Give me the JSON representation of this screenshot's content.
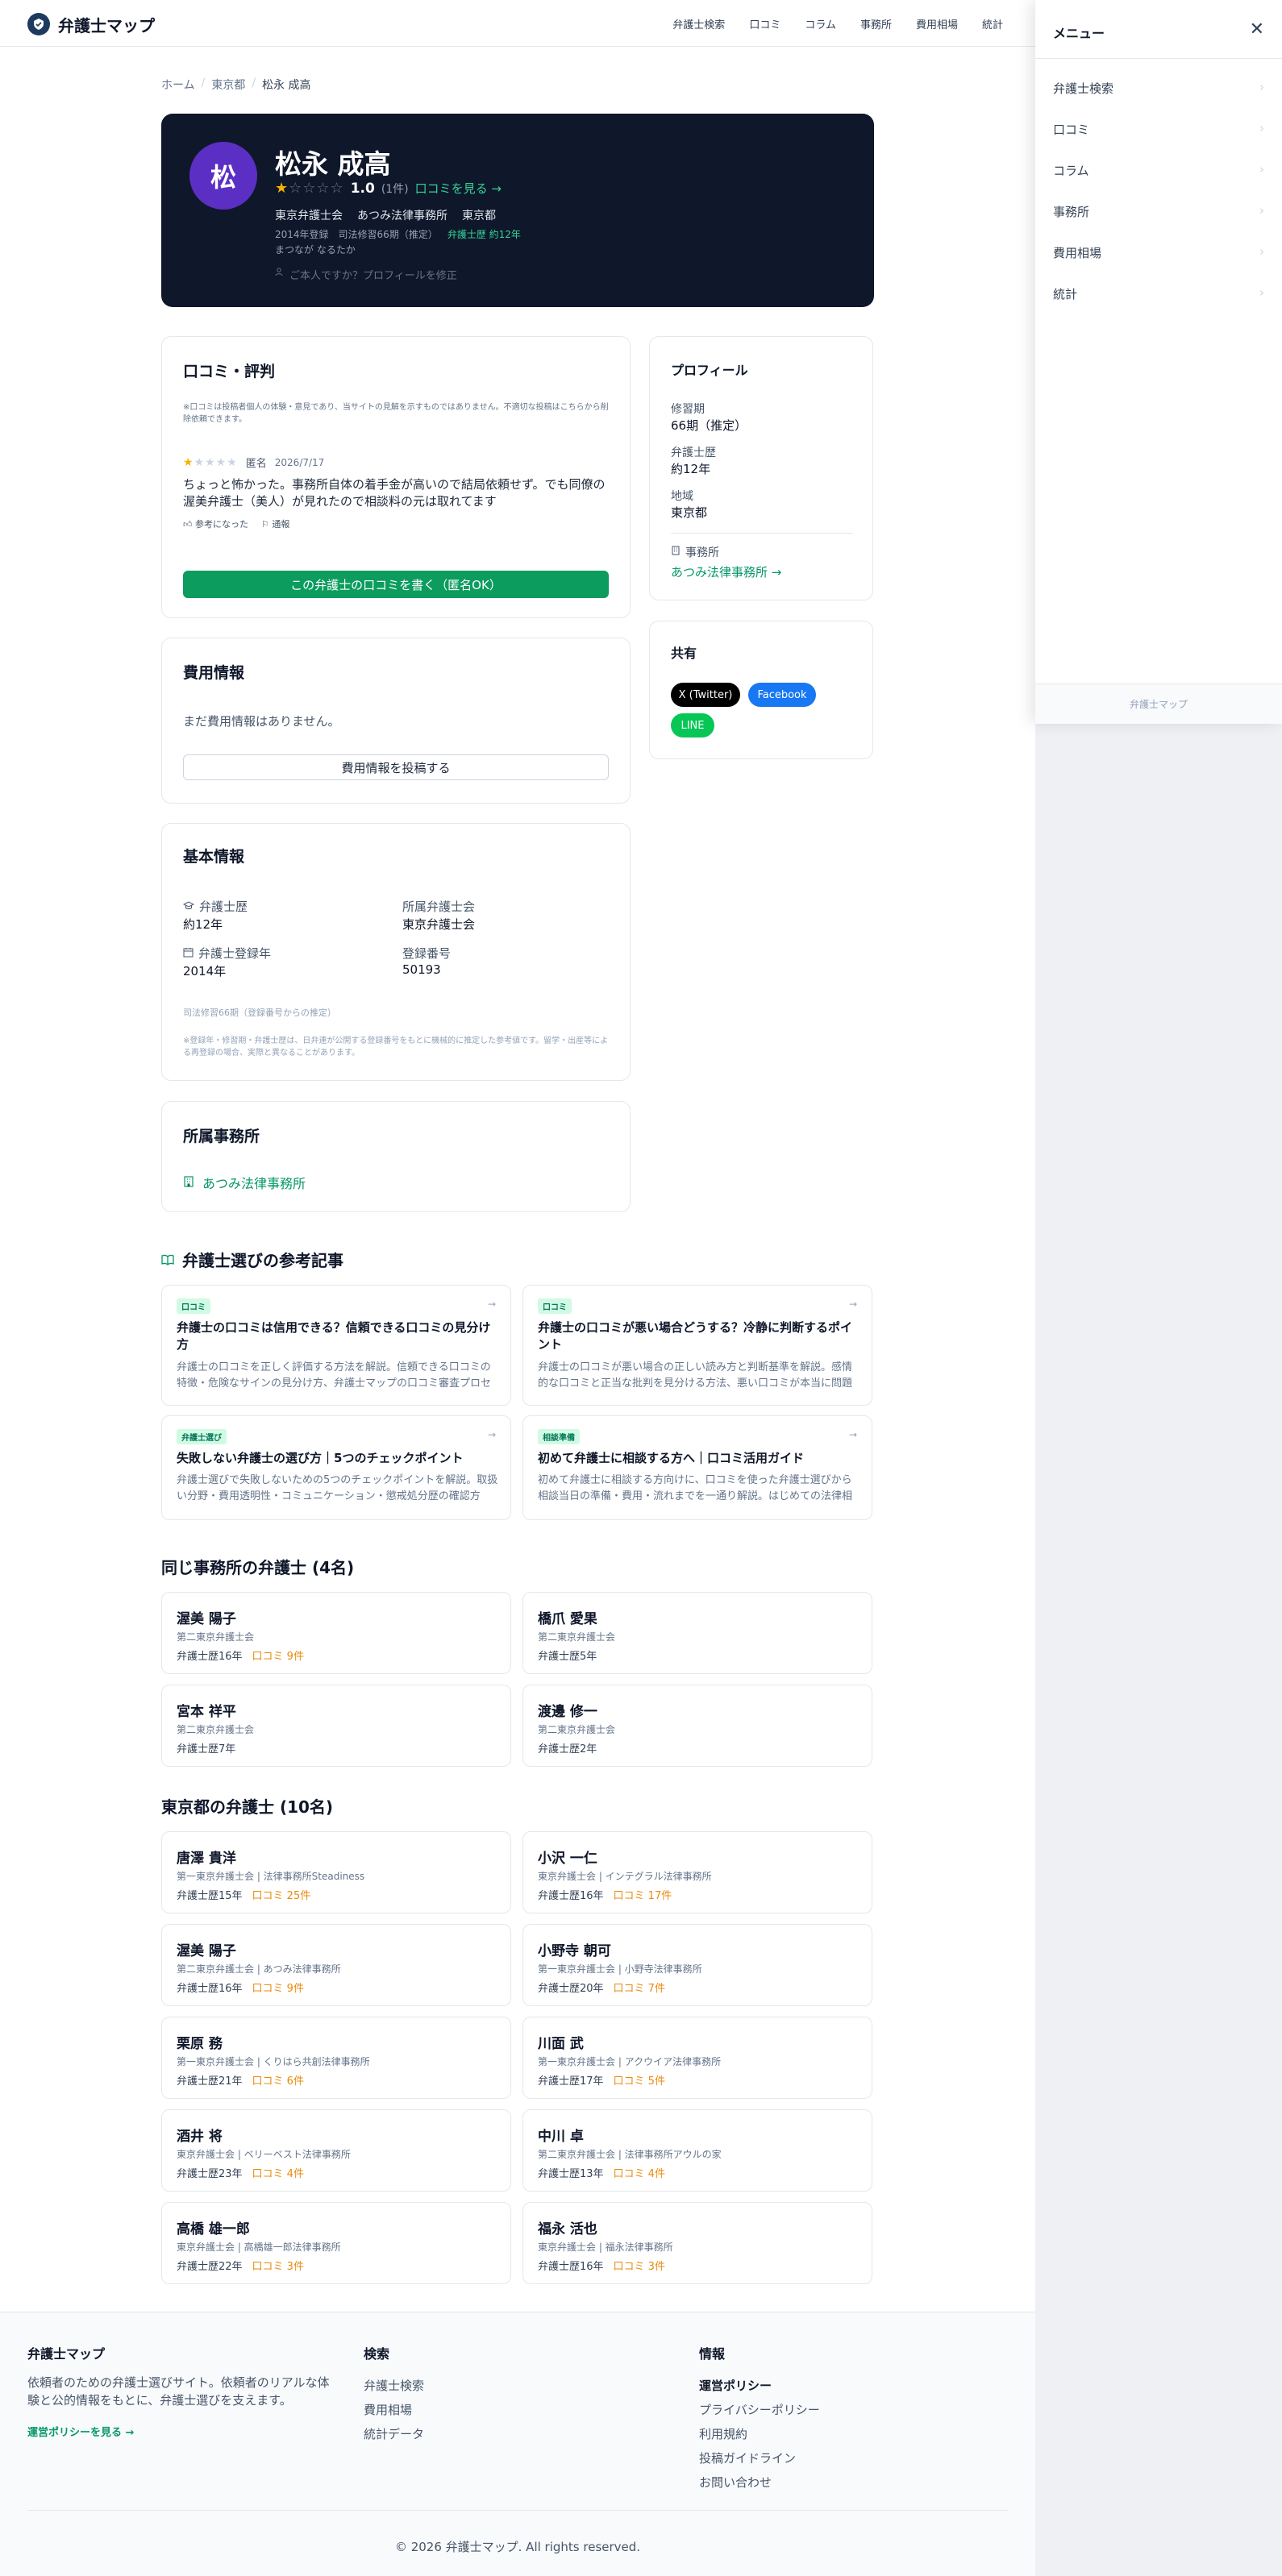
{
  "header": {
    "logo_text": "弁護士マップ",
    "nav": [
      "弁護士検索",
      "口コミ",
      "コラム",
      "事務所",
      "費用相場",
      "統計"
    ]
  },
  "breadcrumb": {
    "home": "ホーム",
    "region": "東京都",
    "current": "松永 成高"
  },
  "hero": {
    "avatar_char": "松",
    "name": "松永 成高",
    "rating": "1.0",
    "rating_value": 1,
    "rating_max": 5,
    "review_count": "(1件)",
    "reviews_link": "口コミを見る →",
    "bar": "東京弁護士会",
    "office": "あつみ法律事務所",
    "region": "東京都",
    "registered": "2014年登録",
    "training": "司法修習66期（推定）",
    "experience": "弁護士歴 約12年",
    "kana": "まつなが なるたか",
    "claim": "ご本人ですか？プロフィールを修正"
  },
  "reviews": {
    "title": "口コミ・評判",
    "notice": "※口コミは投稿者個人の体験・意見であり、当サイトの見解を示すものではありません。不適切な投稿はこちらから削除依頼できます。",
    "items": [
      {
        "rating": 1,
        "author": "匿名",
        "date": "2026/7/17",
        "body": "ちょっと怖かった。事務所自体の着手金が高いので結局依頼せず。でも同僚の渥美弁護士（美人）が見れたので相談料の元は取れてます",
        "helpful": "参考になった",
        "report": "通報"
      }
    ],
    "write_button": "この弁護士の口コミを書く（匿名OK）"
  },
  "profile": {
    "title": "プロフィール",
    "fields": [
      {
        "label": "修習期",
        "value": "66期（推定）"
      },
      {
        "label": "弁護士歴",
        "value": "約12年"
      },
      {
        "label": "地域",
        "value": "東京都"
      }
    ],
    "office_label": "事務所",
    "office_link": "あつみ法律事務所 →"
  },
  "share": {
    "title": "共有",
    "buttons": [
      "X (Twitter)",
      "Facebook",
      "LINE"
    ],
    "colors": {
      "x": "#000000",
      "facebook": "#1877f2",
      "line": "#06c755"
    }
  },
  "fees": {
    "title": "費用情報",
    "empty": "まだ費用情報はありません。",
    "post_button": "費用情報を投稿する"
  },
  "basic": {
    "title": "基本情報",
    "exp_label": "弁護士歴",
    "exp_value": "約12年",
    "bar_label": "所属弁護士会",
    "bar_value": "東京弁護士会",
    "reg_label": "弁護士登録年",
    "reg_value": "2014年",
    "num_label": "登録番号",
    "num_value": "50193",
    "note1": "司法修習66期（登録番号からの推定）",
    "note2": "※登録年・修習期・弁護士歴は、日弁連が公開する登録番号をもとに機械的に推定した参考値です。留学・出産等による再登録の場合、実際と異なることがあります。"
  },
  "office_card": {
    "title": "所属事務所",
    "link": "あつみ法律事務所"
  },
  "articles_section": {
    "title": "弁護士選びの参考記事",
    "items": [
      {
        "tag": "口コミ",
        "title": "弁護士の口コミは信用できる？信頼できる口コミの見分け方",
        "desc": "弁護士の口コミを正しく評価する方法を解説。信頼できる口コミの特徴・危険なサインの見分け方、弁護士マップの口コミ審査プロセス…"
      },
      {
        "tag": "口コミ",
        "title": "弁護士の口コミが悪い場合どうする？冷静に判断するポイント",
        "desc": "弁護士の口コミが悪い場合の正しい読み方と判断基準を解説。感情的な口コミと正当な批判を見分ける方法、悪い口コミが本当に問題に…"
      },
      {
        "tag": "弁護士選び",
        "title": "失敗しない弁護士の選び方｜5つのチェックポイント",
        "desc": "弁護士選びで失敗しないための5つのチェックポイントを解説。取扱い分野・費用透明性・コミュニケーション・懲戒処分歴の確認方法。"
      },
      {
        "tag": "相談準備",
        "title": "初めて弁護士に相談する方へ｜口コミ活用ガイド",
        "desc": "初めて弁護士に相談する方向けに、口コミを使った弁護士選びから相談当日の準備・費用・流れまでを一通り解説。はじめての法律相談…"
      }
    ]
  },
  "same_office": {
    "title": "同じ事務所の弁護士 (4名)",
    "items": [
      {
        "name": "渥美 陽子",
        "bar": "第二東京弁護士会",
        "exp": "弁護士歴16年",
        "reviews": "口コミ 9件"
      },
      {
        "name": "橋爪 愛果",
        "bar": "第二東京弁護士会",
        "exp": "弁護士歴5年",
        "reviews": ""
      },
      {
        "name": "宮本 祥平",
        "bar": "第二東京弁護士会",
        "exp": "弁護士歴7年",
        "reviews": ""
      },
      {
        "name": "渡邊 修一",
        "bar": "第二東京弁護士会",
        "exp": "弁護士歴2年",
        "reviews": ""
      }
    ]
  },
  "region_lawyers": {
    "title": "東京都の弁護士 (10名)",
    "items": [
      {
        "name": "唐澤 貴洋",
        "bar": "第一東京弁護士会 | 法律事務所Steadiness",
        "exp": "弁護士歴15年",
        "reviews": "口コミ 25件"
      },
      {
        "name": "小沢 一仁",
        "bar": "東京弁護士会 | インテグラル法律事務所",
        "exp": "弁護士歴16年",
        "reviews": "口コミ 17件"
      },
      {
        "name": "渥美 陽子",
        "bar": "第二東京弁護士会 | あつみ法律事務所",
        "exp": "弁護士歴16年",
        "reviews": "口コミ 9件"
      },
      {
        "name": "小野寺 朝可",
        "bar": "第一東京弁護士会 | 小野寺法律事務所",
        "exp": "弁護士歴20年",
        "reviews": "口コミ 7件"
      },
      {
        "name": "栗原 務",
        "bar": "第一東京弁護士会 | くりはら共創法律事務所",
        "exp": "弁護士歴21年",
        "reviews": "口コミ 6件"
      },
      {
        "name": "川面 武",
        "bar": "第一東京弁護士会 | アクウイア法律事務所",
        "exp": "弁護士歴17年",
        "reviews": "口コミ 5件"
      },
      {
        "name": "酒井 将",
        "bar": "東京弁護士会 | ベリーベスト法律事務所",
        "exp": "弁護士歴23年",
        "reviews": "口コミ 4件"
      },
      {
        "name": "中川 卓",
        "bar": "第二東京弁護士会 | 法律事務所アウルの家",
        "exp": "弁護士歴13年",
        "reviews": "口コミ 4件"
      },
      {
        "name": "高橋 雄一郎",
        "bar": "東京弁護士会 | 高橋雄一郎法律事務所",
        "exp": "弁護士歴22年",
        "reviews": "口コミ 3件"
      },
      {
        "name": "福永 活也",
        "bar": "東京弁護士会 | 福永法律事務所",
        "exp": "弁護士歴16年",
        "reviews": "口コミ 3件"
      }
    ]
  },
  "footer": {
    "brand": "弁護士マップ",
    "desc": "依頼者のための弁護士選びサイト。依頼者のリアルな体験と公的情報をもとに、弁護士選びを支えます。",
    "policy_link": "運営ポリシーを見る →",
    "search_title": "検索",
    "search_links": [
      "弁護士検索",
      "費用相場",
      "統計データ"
    ],
    "info_title": "情報",
    "info_links": [
      "運営ポリシー",
      "プライバシーポリシー",
      "利用規約",
      "投稿ガイドライン",
      "お問い合わせ"
    ],
    "copyright": "© 2026 弁護士マップ. All rights reserved."
  },
  "drawer": {
    "title": "メニュー",
    "items": [
      "弁護士検索",
      "口コミ",
      "コラム",
      "事務所",
      "費用相場",
      "統計"
    ],
    "footer": "弁護士マップ"
  }
}
